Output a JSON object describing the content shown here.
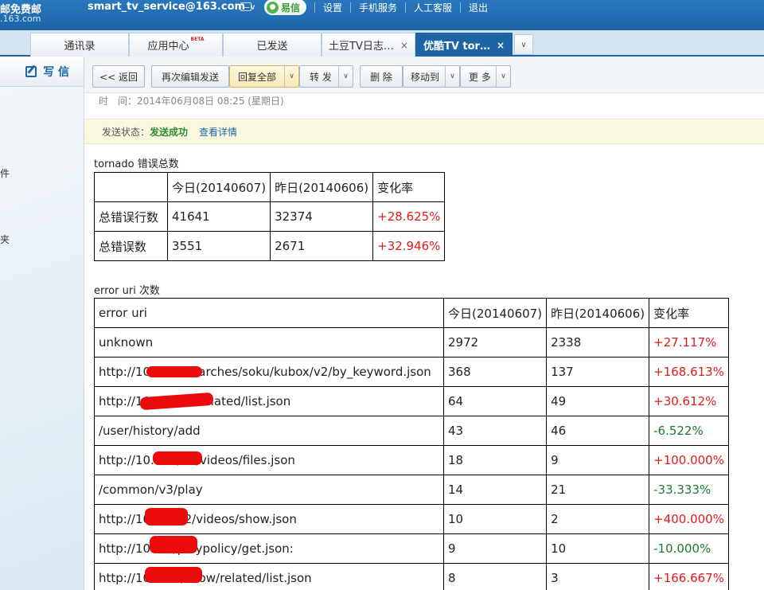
{
  "header": {
    "logo_line1": "邮免费邮",
    "logo_line2": ".163.com",
    "account": "smart_tv_service@163.com",
    "account_caret": "∨",
    "yixin_label": "易信",
    "links": [
      "设置",
      "手机服务",
      "人工客服",
      "退出"
    ]
  },
  "tabs": [
    {
      "label": "通讯录",
      "beta": "",
      "closable": false
    },
    {
      "label": "应用中心",
      "beta": "BETA",
      "closable": false
    },
    {
      "label": "已发送",
      "beta": "",
      "closable": false
    },
    {
      "label": "土豆TV日志…",
      "beta": "",
      "closable": true
    },
    {
      "label": "优酷TV tor…",
      "beta": "",
      "closable": true,
      "active": true
    }
  ],
  "tab_close_glyph": "×",
  "tab_more_glyph": "∨",
  "sidebar": {
    "write_label": "写 信",
    "items": [
      "件",
      "夹"
    ]
  },
  "toolbar": {
    "back": "<< 返回",
    "reedit": "再次编辑发送",
    "reply_all": "回复全部",
    "forward": "转 发",
    "delete": "删 除",
    "move_to": "移动到",
    "more": "更 多",
    "dropdown_glyph": "∨"
  },
  "message": {
    "time_label": "时　间：",
    "time_value": "2014年06月08日 08:25 (星期日)",
    "status_label": "发送状态：",
    "status_value": "发送成功",
    "status_detail": "查看详情"
  },
  "summary": {
    "title": "tornado 错误总数",
    "headers": [
      "",
      "今日(20140607)",
      "昨日(20140606)",
      "变化率"
    ],
    "rows": [
      {
        "label": "总错误行数",
        "today": "41641",
        "yesterday": "32374",
        "rate": "+28.625%",
        "trend": "pos"
      },
      {
        "label": "总错误数",
        "today": "3551",
        "yesterday": "2671",
        "rate": "+32.946%",
        "trend": "pos"
      }
    ]
  },
  "uri_table": {
    "title": "error uri 次数",
    "headers": [
      "error uri",
      "今日(20140607)",
      "昨日(20140606)",
      "变化率"
    ],
    "rows": [
      {
        "uri": "unknown",
        "today": "2972",
        "yesterday": "2338",
        "rate": "+27.117%",
        "trend": "pos"
      },
      {
        "uri": "http://10.         189/searches/soku/kubox/v2/by_keyword.json",
        "today": "368",
        "yesterday": "137",
        "rate": "+168.613%",
        "trend": "pos"
      },
      {
        "uri": "http://10.              /video/related/list.json",
        "today": "64",
        "yesterday": "49",
        "rate": "+30.612%",
        "trend": "pos"
      },
      {
        "uri": "/user/history/add",
        "today": "43",
        "yesterday": "46",
        "rate": "-6.522%",
        "trend": "neg"
      },
      {
        "uri": "http://10.          .11/v2/videos/files.json",
        "today": "18",
        "yesterday": "9",
        "rate": "+100.000%",
        "trend": "pos"
      },
      {
        "uri": "/common/v3/play",
        "today": "14",
        "yesterday": "21",
        "rate": "-33.333%",
        "trend": "neg"
      },
      {
        "uri": "http://10.          11/v2/videos/show.json",
        "today": "10",
        "yesterday": "2",
        "rate": "+400.000%",
        "trend": "pos"
      },
      {
        "uri": "http://10.           13/playpolicy/get.json:",
        "today": "9",
        "yesterday": "10",
        "rate": "-10.000%",
        "trend": "neg"
      },
      {
        "uri": "http://10.          127/show/related/list.json",
        "today": "8",
        "yesterday": "3",
        "rate": "+166.667%",
        "trend": "pos"
      }
    ]
  }
}
